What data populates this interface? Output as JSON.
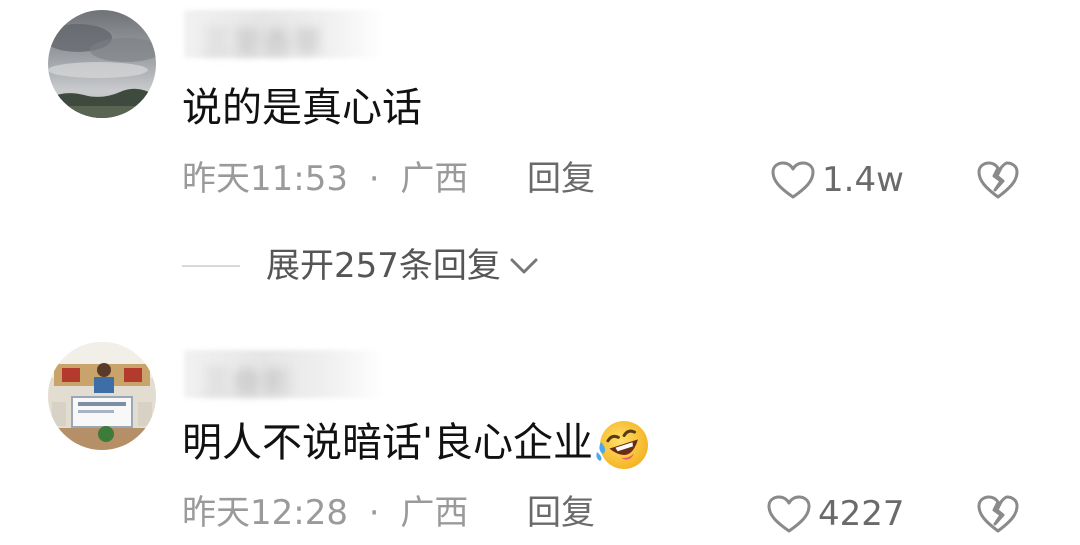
{
  "comments": [
    {
      "username": "三里香草",
      "text": "说的是真心话",
      "time": "昨天11:53",
      "separator": "·",
      "location": "广西",
      "reply_label": "回复",
      "like_count": "1.4w",
      "avatar_icon": "cloudy-landscape-avatar",
      "expand": {
        "label": "展开257条回复"
      }
    },
    {
      "username": "三叠影",
      "text": "明人不说暗话'良心企业",
      "emoji": "rofl-emoji",
      "time": "昨天12:28",
      "separator": "·",
      "location": "广西",
      "reply_label": "回复",
      "like_count": "4227",
      "avatar_icon": "office-meeting-avatar"
    }
  ],
  "icons": {
    "like": "heart-outline-icon",
    "dislike": "broken-heart-icon",
    "expand": "chevron-down-icon"
  },
  "colors": {
    "text": "#111111",
    "meta": "#9a9a9a",
    "icon": "#8a8a8a"
  }
}
